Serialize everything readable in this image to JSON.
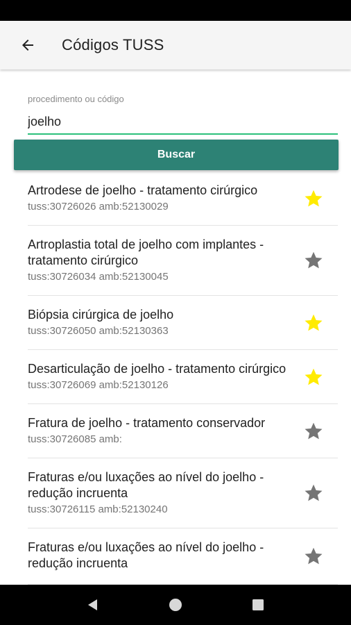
{
  "app_bar": {
    "title": "Códigos TUSS",
    "back_icon": "arrow-back-icon"
  },
  "search": {
    "label": "procedimento ou código",
    "value": "joelho",
    "button_label": "Buscar"
  },
  "colors": {
    "accent": "#2d8275",
    "input_underline": "#2bc07a",
    "star_favorite": "#ffeb00",
    "star_default": "#757575"
  },
  "results": [
    {
      "title": "Artrodese de joelho - tratamento cirúrgico",
      "codes": "tuss:30726026 amb:52130029",
      "favorite": true
    },
    {
      "title": "Artroplastia total de joelho com implantes - tratamento cirúrgico",
      "codes": "tuss:30726034 amb:52130045",
      "favorite": false
    },
    {
      "title": "Biópsia cirúrgica de joelho",
      "codes": "tuss:30726050 amb:52130363",
      "favorite": true
    },
    {
      "title": "Desarticulação de joelho - tratamento cirúrgico",
      "codes": "tuss:30726069 amb:52130126",
      "favorite": true
    },
    {
      "title": "Fratura de joelho - tratamento conservador",
      "codes": "tuss:30726085 amb:",
      "favorite": false
    },
    {
      "title": "Fraturas e/ou luxações ao nível do joelho - redução incruenta",
      "codes": "tuss:30726115 amb:52130240",
      "favorite": false
    },
    {
      "title": "Fraturas e/ou luxações ao nível do joelho - redução incruenta",
      "codes": "",
      "favorite": false
    }
  ],
  "nav": {
    "back_icon": "nav-back-icon",
    "home_icon": "nav-home-icon",
    "recents_icon": "nav-recents-icon"
  }
}
